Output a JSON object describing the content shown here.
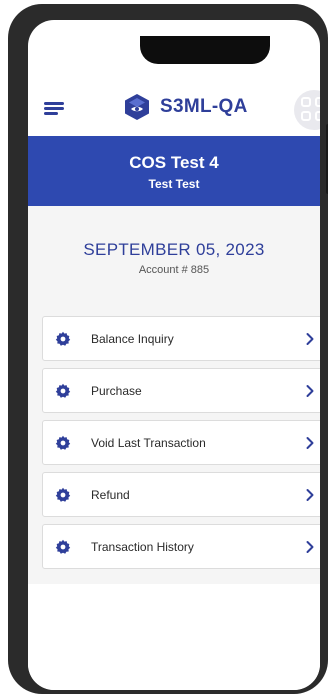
{
  "header": {
    "brand_name": "S3ML-QA",
    "menu_icon": "hamburger-icon",
    "grid_icon": "grid-icon",
    "logo_icon": "s3ml-logo"
  },
  "title_band": {
    "name": "COS Test 4",
    "subtitle": "Test Test"
  },
  "summary": {
    "date": "SEPTEMBER 05, 2023",
    "account": "Account # 885"
  },
  "menu": {
    "items": [
      {
        "label": "Balance Inquiry",
        "icon": "gear-icon"
      },
      {
        "label": "Purchase",
        "icon": "gear-icon"
      },
      {
        "label": "Void Last Transaction",
        "icon": "gear-icon"
      },
      {
        "label": "Refund",
        "icon": "gear-icon"
      },
      {
        "label": "Transaction History",
        "icon": "gear-icon"
      }
    ]
  },
  "colors": {
    "brand": "#2f3f9a",
    "band": "#2e49b0",
    "background": "#f5f5f5"
  }
}
